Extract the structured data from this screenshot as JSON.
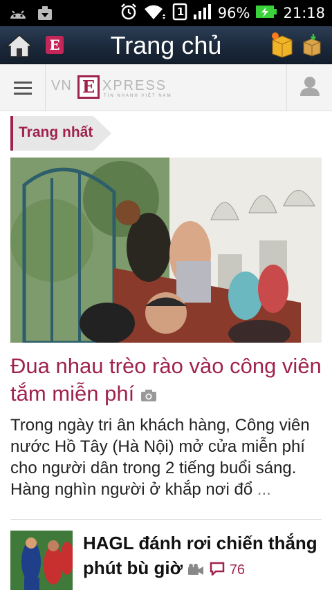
{
  "status_bar": {
    "battery": "96%",
    "time": "21:18",
    "sim": "1"
  },
  "action_bar": {
    "title": "Trang chủ",
    "logo_letter": "E"
  },
  "vn_header": {
    "logo_vn": "VN",
    "logo_e": "E",
    "logo_xpress": "XPRESS",
    "logo_tagline": "TIN NHANH VIỆT NAM"
  },
  "section": {
    "label": "Trang nhất"
  },
  "lead_article": {
    "headline": "Đua nhau trèo rào vào công viên tắm miễn phí",
    "summary": "Trong ngày tri ân khách hàng, Công viên nước Hồ Tây (Hà Nội) mở cửa miễn phí cho người dân trong 2 tiếng buổi sáng. Hàng nghìn người ở khắp nơi đổ",
    "ellipsis": "..."
  },
  "second_article": {
    "headline": "HAGL đánh rơi chiến thắng phút bù giờ",
    "comments": "76"
  },
  "colors": {
    "brand": "#9f224e",
    "actionbar": "#1c2a3d"
  }
}
